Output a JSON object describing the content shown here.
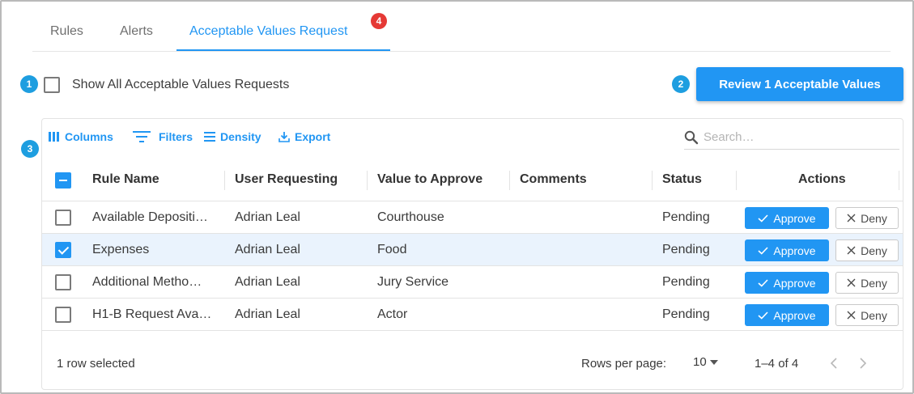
{
  "tabs": [
    {
      "label": "Rules"
    },
    {
      "label": "Alerts"
    },
    {
      "label": "Acceptable Values Request",
      "badge": "4",
      "active": true
    }
  ],
  "markers": [
    "1",
    "2",
    "3"
  ],
  "show_all": {
    "label": "Show All Acceptable Values Requests",
    "checked": false
  },
  "review_button": {
    "label": "Review 1 Acceptable Values"
  },
  "toolbar": {
    "columns": "Columns",
    "filters": "Filters",
    "density": "Density",
    "export": "Export"
  },
  "search": {
    "placeholder": "Search…"
  },
  "table": {
    "headers": [
      "Rule Name",
      "User Requesting",
      "Value to Approve",
      "Comments",
      "Status",
      "Actions"
    ],
    "rows": [
      {
        "rule": "Available Depositi…",
        "user": "Adrian Leal",
        "value": "Courthouse",
        "comments": "",
        "status": "Pending",
        "selected": false
      },
      {
        "rule": "Expenses",
        "user": "Adrian Leal",
        "value": "Food",
        "comments": "",
        "status": "Pending",
        "selected": true
      },
      {
        "rule": "Additional Metho…",
        "user": "Adrian Leal",
        "value": "Jury Service",
        "comments": "",
        "status": "Pending",
        "selected": false
      },
      {
        "rule": "H1-B Request Ava…",
        "user": "Adrian Leal",
        "value": "Actor",
        "comments": "",
        "status": "Pending",
        "selected": false
      }
    ],
    "approve_label": "Approve",
    "deny_label": "Deny"
  },
  "footer": {
    "selected_text": "1 row selected",
    "rows_per_page_label": "Rows per page:",
    "rows_per_page_value": "10",
    "range": "1–4 of 4"
  },
  "colors": {
    "accent": "#2196f3",
    "badge": "#e53935",
    "marker": "#1e9ee0",
    "selected_row": "#eaf3fd"
  }
}
